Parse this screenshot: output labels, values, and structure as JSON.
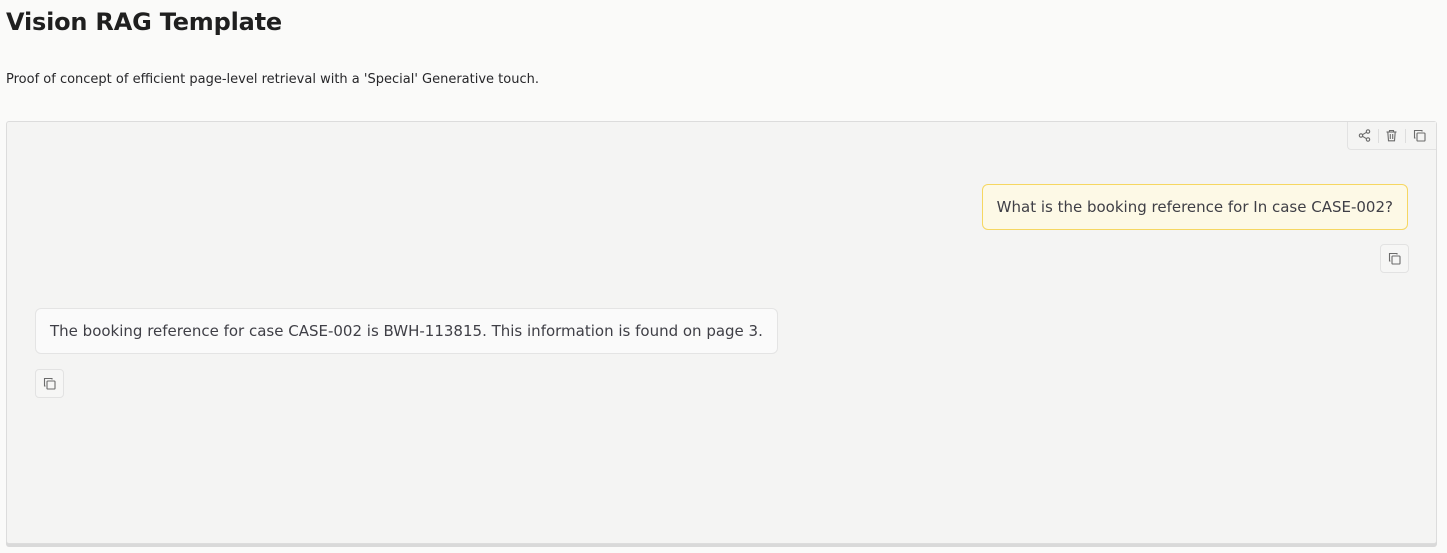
{
  "header": {
    "title": "Vision RAG Template",
    "description": "Proof of concept of efficient page-level retrieval with a 'Special' Generative touch."
  },
  "chat": {
    "toolbar": {
      "icons": [
        "share-icon",
        "trash-icon",
        "copy-icon"
      ]
    },
    "messages": [
      {
        "role": "user",
        "text": "What is the booking reference for In case CASE-002?"
      },
      {
        "role": "assistant",
        "text": "The booking reference for case CASE-002 is BWH-113815. This information is found on page 3."
      }
    ]
  },
  "colors": {
    "user_bubble_bg": "#fdf9e6",
    "user_bubble_border": "#f6d761",
    "bot_bubble_bg": "#fafafa",
    "chat_bg": "#f4f4f3"
  }
}
